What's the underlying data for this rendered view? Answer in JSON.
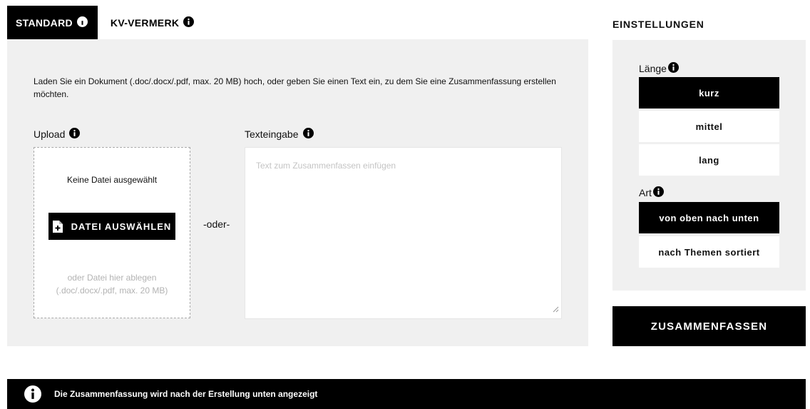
{
  "tabs": [
    {
      "label": "STANDARD",
      "active": true,
      "icon": "info-icon"
    },
    {
      "label": "KV-VERMERK",
      "active": false,
      "icon": "info-icon"
    }
  ],
  "main": {
    "intro": "Laden Sie ein Dokument (.doc/.docx/.pdf, max. 20 MB) hoch, oder geben Sie einen Text ein, zu dem Sie eine Zusammenfassung erstellen möchten.",
    "upload": {
      "label": "Upload",
      "no_file": "Keine Datei ausgewählt",
      "button": "DATEI AUSWÄHLEN",
      "drop_hint_1": "oder Datei hier ablegen",
      "drop_hint_2": "(.doc/.docx/.pdf, max. 20 MB)"
    },
    "separator": "-oder-",
    "text_input": {
      "label": "Texteingabe",
      "placeholder": "Text zum Zusammenfassen einfügen",
      "value": ""
    }
  },
  "settings": {
    "title": "EINSTELLUNGEN",
    "length": {
      "label": "Länge",
      "options": [
        "kurz",
        "mittel",
        "lang"
      ],
      "selected": "kurz"
    },
    "type": {
      "label": "Art",
      "options": [
        "von oben nach unten",
        "nach Themen sortiert"
      ],
      "selected": "von oben nach unten"
    },
    "submit": "ZUSAMMENFASSEN"
  },
  "notice": {
    "text": "Die Zusammenfassung wird nach der Erstellung unten angezeigt",
    "icon": "info-icon"
  },
  "colors": {
    "accent": "#000000",
    "panel_background": "#f0f0f0",
    "page_background": "#ffffff"
  }
}
